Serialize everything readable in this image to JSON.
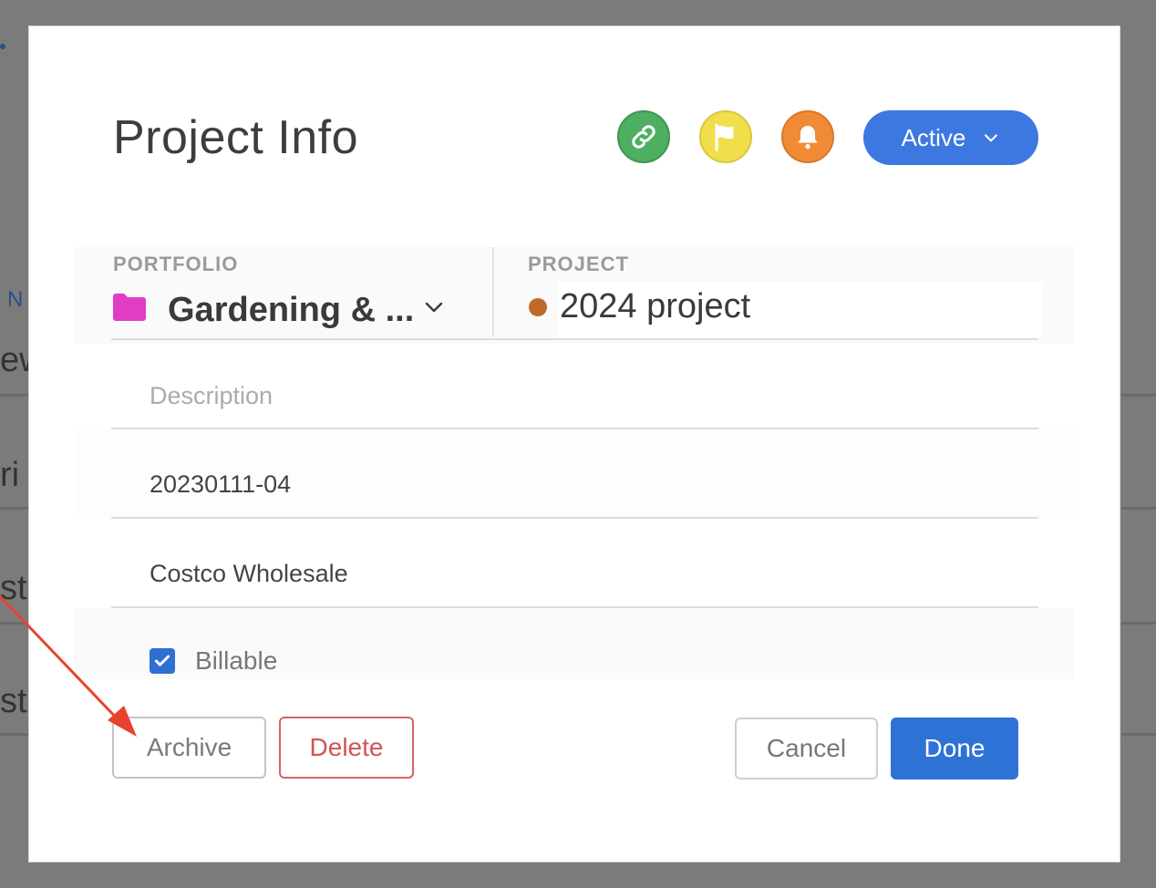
{
  "background": {
    "fragments": [
      "N",
      "ew",
      "ri",
      "st",
      "st"
    ]
  },
  "modal": {
    "title": "Project Info",
    "header_icons": [
      "link-icon",
      "flag-icon",
      "bell-icon"
    ],
    "status": {
      "label": "Active"
    },
    "portfolio": {
      "label": "PORTFOLIO",
      "value": "Gardening & ...",
      "color": "#e03cc4"
    },
    "project": {
      "label": "PROJECT",
      "value": "2024 project",
      "color": "#c0692a"
    },
    "description": {
      "placeholder": "Description",
      "value": ""
    },
    "project_code": "20230111-04",
    "client": "Costco Wholesale",
    "billable": {
      "label": "Billable",
      "checked": true
    },
    "buttons": {
      "archive": "Archive",
      "delete": "Delete",
      "cancel": "Cancel",
      "done": "Done"
    }
  },
  "colors": {
    "accent": "#2e72d6",
    "link_button": "#4caf62",
    "flag_button": "#f0de4a",
    "bell_button": "#f08a35",
    "delete": "#d15555",
    "annotation_arrow": "#e8432e"
  }
}
